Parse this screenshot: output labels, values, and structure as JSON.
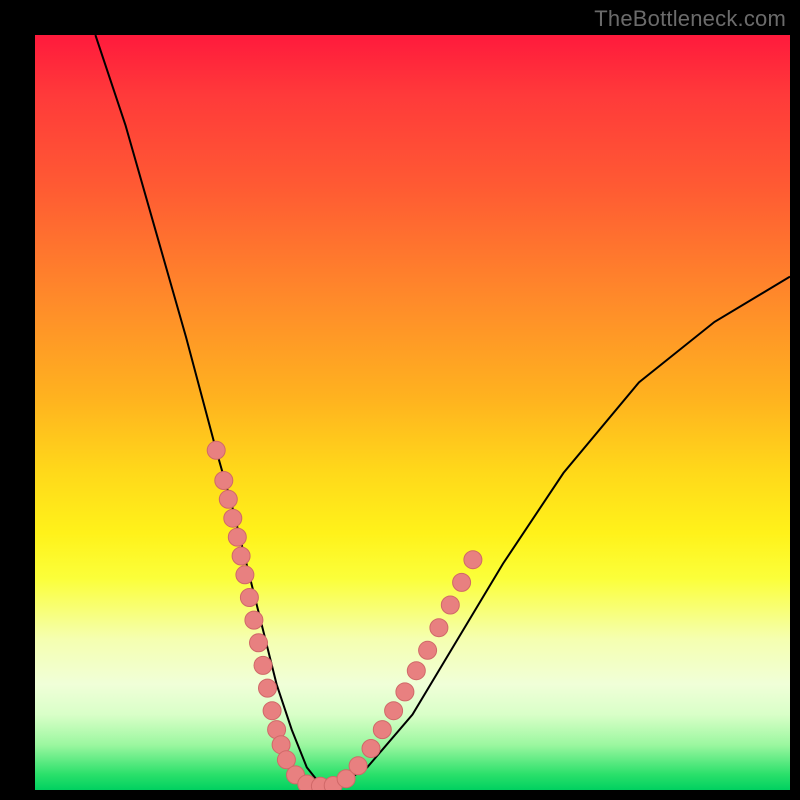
{
  "watermark": "TheBottleneck.com",
  "chart_data": {
    "type": "line",
    "title": "",
    "xlabel": "",
    "ylabel": "",
    "xlim": [
      0,
      100
    ],
    "ylim": [
      0,
      100
    ],
    "grid": false,
    "legend": false,
    "series": [
      {
        "name": "bottleneck-curve",
        "x": [
          8,
          12,
          16,
          20,
          24,
          26,
          28,
          30,
          32,
          34,
          36,
          38,
          40,
          44,
          50,
          56,
          62,
          70,
          80,
          90,
          100
        ],
        "y": [
          100,
          88,
          74,
          60,
          45,
          38,
          30,
          22,
          14,
          8,
          3,
          0.5,
          0.5,
          3,
          10,
          20,
          30,
          42,
          54,
          62,
          68
        ]
      },
      {
        "name": "data-points-left",
        "type": "scatter",
        "x": [
          24.0,
          25.0,
          25.6,
          26.2,
          26.8,
          27.3,
          27.8,
          28.4,
          29.0,
          29.6,
          30.2,
          30.8,
          31.4,
          32.0,
          32.6,
          33.3
        ],
        "y": [
          45.0,
          41.0,
          38.5,
          36.0,
          33.5,
          31.0,
          28.5,
          25.5,
          22.5,
          19.5,
          16.5,
          13.5,
          10.5,
          8.0,
          6.0,
          4.0
        ]
      },
      {
        "name": "data-points-bottom",
        "type": "scatter",
        "x": [
          34.5,
          36.0,
          37.8,
          39.5,
          41.2,
          42.8
        ],
        "y": [
          2.0,
          0.8,
          0.5,
          0.6,
          1.5,
          3.2
        ]
      },
      {
        "name": "data-points-right",
        "x": [
          44.5,
          46.0,
          47.5,
          49.0,
          50.5,
          52.0,
          53.5,
          55.0,
          56.5,
          58.0
        ],
        "y": [
          5.5,
          8.0,
          10.5,
          13.0,
          15.8,
          18.5,
          21.5,
          24.5,
          27.5,
          30.5
        ]
      }
    ],
    "colors": {
      "curve": "#000000",
      "points_fill": "#e88080",
      "points_stroke": "#d06868"
    }
  }
}
